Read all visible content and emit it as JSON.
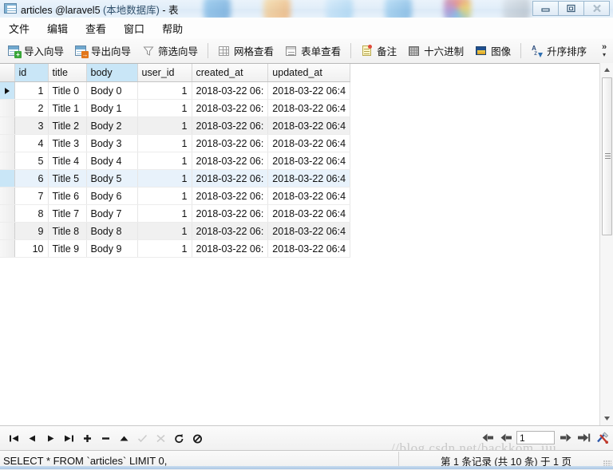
{
  "window": {
    "icon": "table-window-icon",
    "title_main": "articles @laravel5",
    "title_paren": "(本地数据库)",
    "title_suffix": "- 表",
    "minimize_label": "最小化",
    "maximize_label": "还原",
    "close_label": "关闭"
  },
  "menubar": {
    "items": [
      {
        "label": "文件"
      },
      {
        "label": "编辑"
      },
      {
        "label": "查看"
      },
      {
        "label": "窗口"
      },
      {
        "label": "帮助"
      }
    ]
  },
  "toolbar": {
    "items": [
      {
        "label": "导入向导",
        "icon": "import-wizard-icon"
      },
      {
        "label": "导出向导",
        "icon": "export-wizard-icon"
      },
      {
        "label": "筛选向导",
        "icon": "filter-wizard-icon"
      },
      {
        "label": "网格查看",
        "icon": "grid-view-icon"
      },
      {
        "label": "表单查看",
        "icon": "form-view-icon"
      },
      {
        "label": "备注",
        "icon": "memo-icon"
      },
      {
        "label": "十六进制",
        "icon": "hex-icon"
      },
      {
        "label": "图像",
        "icon": "image-icon"
      },
      {
        "label": "升序排序",
        "icon": "sort-ascending-icon"
      }
    ],
    "overflow_label": "»"
  },
  "grid": {
    "columns": [
      {
        "name": "id",
        "selected": true,
        "align": "right"
      },
      {
        "name": "title",
        "selected": false,
        "align": "left"
      },
      {
        "name": "body",
        "selected": true,
        "align": "left"
      },
      {
        "name": "user_id",
        "selected": false,
        "align": "right"
      },
      {
        "name": "created_at",
        "selected": false,
        "align": "left"
      },
      {
        "name": "updated_at",
        "selected": false,
        "align": "left"
      }
    ],
    "rows": [
      {
        "id": "1",
        "title": "Title 0",
        "body": "Body 0",
        "user_id": "1",
        "created_at": "2018-03-22 06:",
        "updated_at": "2018-03-22 06:4",
        "state": "current"
      },
      {
        "id": "2",
        "title": "Title 1",
        "body": "Body 1",
        "user_id": "1",
        "created_at": "2018-03-22 06:",
        "updated_at": "2018-03-22 06:4",
        "state": "normal"
      },
      {
        "id": "3",
        "title": "Title 2",
        "body": "Body 2",
        "user_id": "1",
        "created_at": "2018-03-22 06:",
        "updated_at": "2018-03-22 06:4",
        "state": "alt"
      },
      {
        "id": "4",
        "title": "Title 3",
        "body": "Body 3",
        "user_id": "1",
        "created_at": "2018-03-22 06:",
        "updated_at": "2018-03-22 06:4",
        "state": "normal"
      },
      {
        "id": "5",
        "title": "Title 4",
        "body": "Body 4",
        "user_id": "1",
        "created_at": "2018-03-22 06:",
        "updated_at": "2018-03-22 06:4",
        "state": "normal"
      },
      {
        "id": "6",
        "title": "Title 5",
        "body": "Body 5",
        "user_id": "1",
        "created_at": "2018-03-22 06:",
        "updated_at": "2018-03-22 06:4",
        "state": "highlight"
      },
      {
        "id": "7",
        "title": "Title 6",
        "body": "Body 6",
        "user_id": "1",
        "created_at": "2018-03-22 06:",
        "updated_at": "2018-03-22 06:4",
        "state": "normal"
      },
      {
        "id": "8",
        "title": "Title 7",
        "body": "Body 7",
        "user_id": "1",
        "created_at": "2018-03-22 06:",
        "updated_at": "2018-03-22 06:4",
        "state": "normal"
      },
      {
        "id": "9",
        "title": "Title 8",
        "body": "Body 8",
        "user_id": "1",
        "created_at": "2018-03-22 06:",
        "updated_at": "2018-03-22 06:4",
        "state": "alt"
      },
      {
        "id": "10",
        "title": "Title 9",
        "body": "Body 9",
        "user_id": "1",
        "created_at": "2018-03-22 06:",
        "updated_at": "2018-03-22 06:4",
        "state": "normal"
      }
    ]
  },
  "navbar": {
    "buttons": [
      {
        "icon": "first-record-icon",
        "enabled": true
      },
      {
        "icon": "previous-record-icon",
        "enabled": true
      },
      {
        "icon": "next-record-icon",
        "enabled": true
      },
      {
        "icon": "last-record-icon",
        "enabled": true
      },
      {
        "icon": "add-record-icon",
        "enabled": true
      },
      {
        "icon": "delete-record-icon",
        "enabled": true
      },
      {
        "icon": "edit-record-icon",
        "enabled": true
      },
      {
        "icon": "apply-change-icon",
        "enabled": false
      },
      {
        "icon": "cancel-change-icon",
        "enabled": false
      },
      {
        "icon": "refresh-icon",
        "enabled": true
      },
      {
        "icon": "stop-icon",
        "enabled": true
      }
    ],
    "pager": {
      "first_page_icon": "first-page-icon",
      "prev_page_icon": "previous-page-icon",
      "page_value": "1",
      "page_placeholder": "1",
      "next_page_icon": "next-page-icon",
      "last_page_icon": "last-page-icon",
      "tools_icon": "tools-icon"
    }
  },
  "statusbar": {
    "sql": "SELECT * FROM `articles` LIMIT 0,",
    "record_info": "第 1 条记录 (共 10 条) 于 1 页"
  },
  "watermark": {
    "text": "//blog.csdn.net/backkom_jiu"
  },
  "scrollbar": {
    "up_arrow_icon": "scroll-up-icon",
    "down_arrow_icon": "scroll-down-icon",
    "thumb_label": "vertical-scroll-thumb"
  },
  "colors": {
    "header_selected": "#c9e6f7",
    "row_highlight": "#e8f2fb",
    "row_alt": "#f0f0f0",
    "title_gradient_top": "#eaf3fb",
    "accent": "#2f6fb0"
  }
}
